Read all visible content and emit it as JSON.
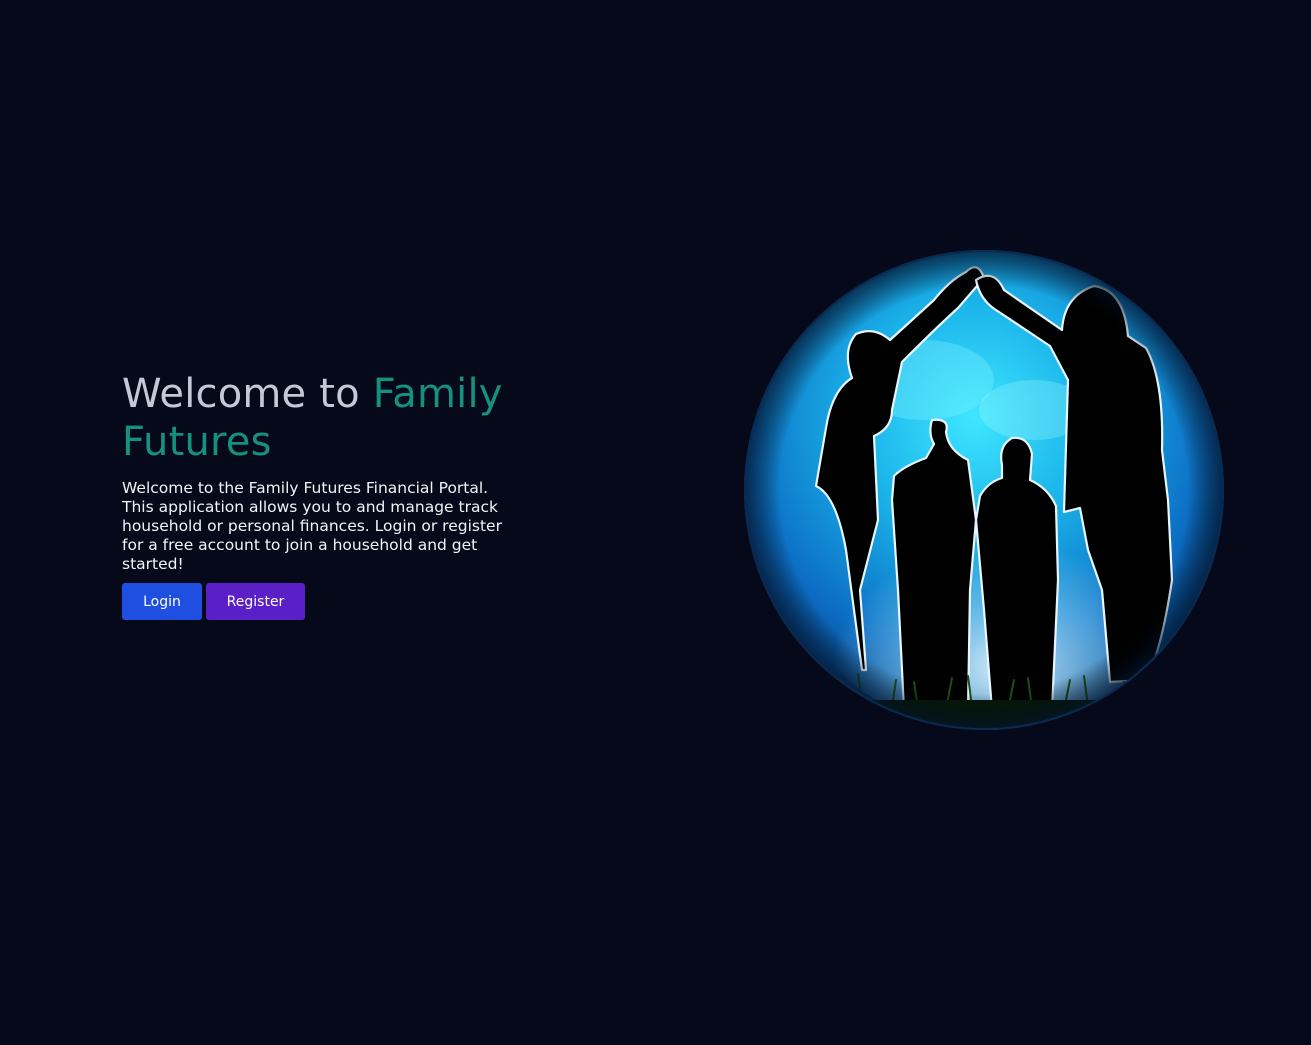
{
  "hero": {
    "title_lead": "Welcome to ",
    "title_brand": "Family Futures",
    "intro": "Welcome to the Family Futures Financial Portal. This application allows you to and manage track household or personal finances. Login or register for a free account to join a household and get started!",
    "login_label": "Login",
    "register_label": "Register"
  },
  "illustration": {
    "icon": "family-silhouette-globe"
  },
  "colors": {
    "background": "#060919",
    "brand_accent": "#15917f",
    "login_button": "#1e4fe0",
    "register_button": "#5a1fc7"
  }
}
